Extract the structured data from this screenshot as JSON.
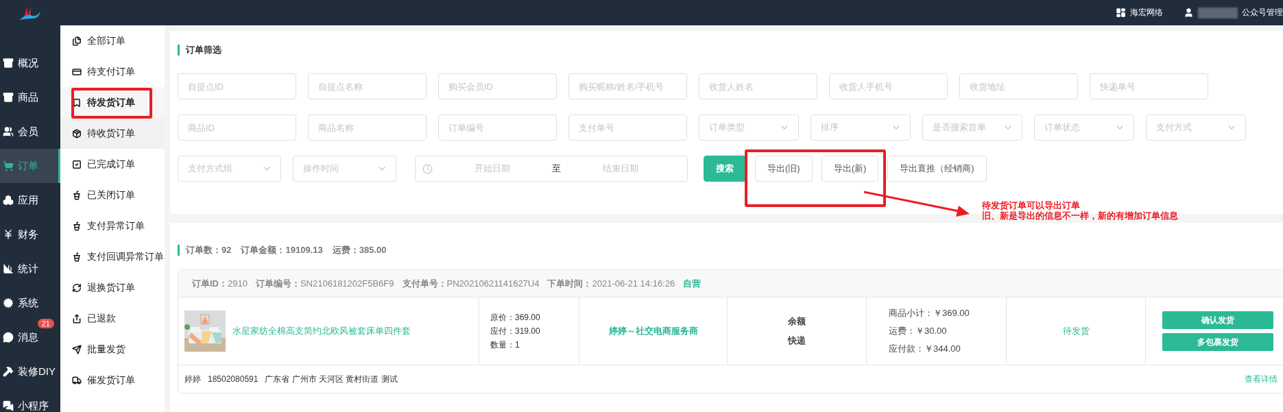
{
  "top_bar": {
    "items": [
      {
        "kind": "org",
        "label": "海宏网络"
      },
      {
        "kind": "user",
        "label": "公众号管理"
      }
    ]
  },
  "sidebar": {
    "items": [
      {
        "label": "概况",
        "selected": false
      },
      {
        "label": "商品",
        "selected": false
      },
      {
        "label": "会员",
        "selected": false
      },
      {
        "label": "订单",
        "selected": true
      },
      {
        "label": "应用",
        "selected": false
      },
      {
        "label": "财务",
        "selected": false
      },
      {
        "label": "统计",
        "selected": false
      },
      {
        "label": "系统",
        "selected": false
      },
      {
        "label": "消息",
        "selected": false,
        "badge": "21"
      },
      {
        "label": "装修DIY",
        "selected": false
      },
      {
        "label": "小程序",
        "selected": false
      }
    ]
  },
  "submenu": {
    "items": [
      {
        "label": "全部订单",
        "selected": false,
        "hovered": false
      },
      {
        "label": "待支付订单",
        "selected": false,
        "hovered": false
      },
      {
        "label": "待发货订单",
        "selected": true,
        "hovered": false
      },
      {
        "label": "待收货订单",
        "selected": false,
        "hovered": true
      },
      {
        "label": "已完成订单",
        "selected": false,
        "hovered": false
      },
      {
        "label": "已关闭订单",
        "selected": false,
        "hovered": false
      },
      {
        "label": "支付异常订单",
        "selected": false,
        "hovered": false
      },
      {
        "label": "支付回调异常订单",
        "selected": false,
        "hovered": false
      },
      {
        "label": "退换货订单",
        "selected": false,
        "hovered": false
      },
      {
        "label": "已退款",
        "selected": false,
        "hovered": false
      },
      {
        "label": "批量发货",
        "selected": false,
        "hovered": false
      },
      {
        "label": "催发货订单",
        "selected": false,
        "hovered": false
      }
    ]
  },
  "filter": {
    "title": "订单筛选",
    "rows": [
      [
        {
          "kind": "input",
          "placeholder": "自提点ID"
        },
        {
          "kind": "input",
          "placeholder": "自提点名称"
        },
        {
          "kind": "input",
          "placeholder": "购买会员ID"
        },
        {
          "kind": "input",
          "placeholder": "购买昵称/姓名/手机号"
        },
        {
          "kind": "input",
          "placeholder": "收货人姓名"
        },
        {
          "kind": "input",
          "placeholder": "收货人手机号"
        },
        {
          "kind": "input",
          "placeholder": "收货地址"
        },
        {
          "kind": "input",
          "placeholder": "快递单号"
        }
      ],
      [
        {
          "kind": "input",
          "placeholder": "商品ID"
        },
        {
          "kind": "input",
          "placeholder": "商品名称"
        },
        {
          "kind": "input",
          "placeholder": "订单编号"
        },
        {
          "kind": "input",
          "placeholder": "支付单号"
        },
        {
          "kind": "select",
          "placeholder": "订单类型"
        },
        {
          "kind": "select",
          "placeholder": "排序"
        },
        {
          "kind": "select",
          "placeholder": "是否搜索首单"
        },
        {
          "kind": "select",
          "placeholder": "订单状态"
        },
        {
          "kind": "select",
          "placeholder": "支付方式"
        }
      ],
      [
        {
          "kind": "wide-select",
          "placeholder": "支付方式组"
        },
        {
          "kind": "wide-select",
          "placeholder": "操作时间"
        }
      ]
    ],
    "date_range": {
      "start_placeholder": "开始日期",
      "separator": "至",
      "end_placeholder": "结束日期"
    },
    "buttons": [
      {
        "kind": "primary",
        "label": "搜索"
      },
      {
        "kind": "plain",
        "label": "导出(旧)"
      },
      {
        "kind": "plain",
        "label": "导出(新)"
      },
      {
        "kind": "plain",
        "label": "导出直推（经销商)"
      }
    ]
  },
  "summary": [
    {
      "label": "订单数：",
      "value": "92"
    },
    {
      "label": "订单金额：",
      "value": "19109.13"
    },
    {
      "label": "运费：",
      "value": "385.00"
    }
  ],
  "order": {
    "header": [
      {
        "label": "订单ID：",
        "value": "2910"
      },
      {
        "label": "订单编号：",
        "value": "SN2106181202F5B6F9"
      },
      {
        "label": "支付单号：",
        "value": "PN20210621141627U4"
      },
      {
        "label": "下单时间：",
        "value": "2021-06-21 14:16:26"
      }
    ],
    "tag": "自营",
    "product": {
      "name": "水星家纺全棉高支简约北欧风被套床单四件套"
    },
    "prices": [
      "原价：369.00",
      "应付：319.00",
      "数量：1"
    ],
    "merchant": "婷婷～社交电商服务商",
    "payment": [
      "余额",
      "快递"
    ],
    "totals": [
      "商品小计：￥369.00",
      "运费：￥30.00",
      "应付款：￥344.00"
    ],
    "status": "待发货",
    "actions": [
      "确认发货",
      "多包裹发货"
    ],
    "address": "婷婷   18502080591   广东省 广州市 天河区 黄村街道 测试",
    "detail_link": "查看详情"
  },
  "annotation": {
    "lines": [
      "待发货订单可以导出订单",
      "旧、新是导出的信息不一样，新的有增加订单信息"
    ]
  }
}
